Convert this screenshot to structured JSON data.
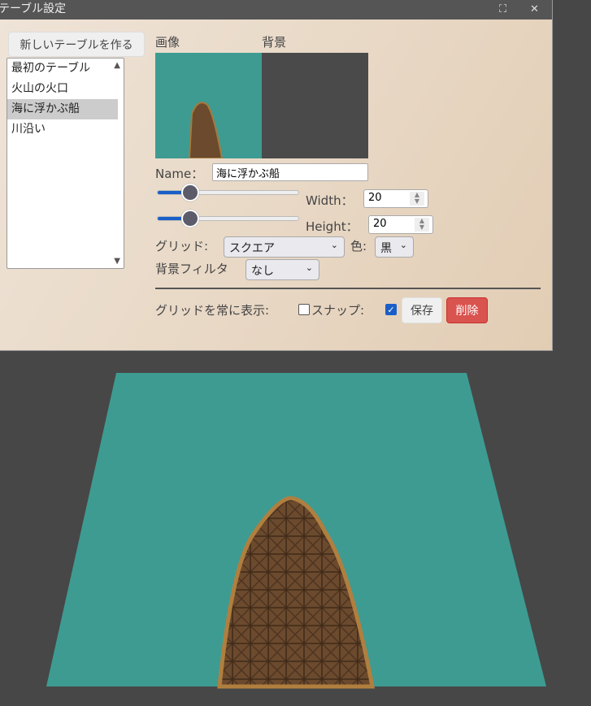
{
  "window": {
    "title": "テーブル設定",
    "maximize_icon": "maximize-icon",
    "close_label": "✕"
  },
  "new_table_button": "新しいテーブルを作る",
  "tables": [
    {
      "label": "最初のテーブル"
    },
    {
      "label": "火山の火口"
    },
    {
      "label": "海に浮かぶ船",
      "selected": true
    },
    {
      "label": "川沿い"
    }
  ],
  "preview": {
    "image_label": "画像",
    "background_label": "背景"
  },
  "name": {
    "label": "Name：",
    "value": "海に浮かぶ船"
  },
  "width": {
    "label": "Width：",
    "value": "20",
    "slider_fraction": 0.23
  },
  "height": {
    "label": "Height：",
    "value": "20",
    "slider_fraction": 0.23
  },
  "grid": {
    "label": "グリッド:",
    "value": "スクエア",
    "color_label": "色:",
    "color_value": "黒"
  },
  "bg_filter": {
    "label": "背景フィルタ",
    "value": "なし"
  },
  "footer": {
    "always_show_grid_label": "グリッドを常に表示:",
    "always_show_grid": false,
    "snap_label": "スナップ:",
    "snap": true,
    "save": "保存",
    "delete": "削除"
  },
  "colors": {
    "accent": "#1a5fc8",
    "delete": "#d9534f",
    "water": "#3e9b92",
    "wood": "#6b4a2e"
  }
}
